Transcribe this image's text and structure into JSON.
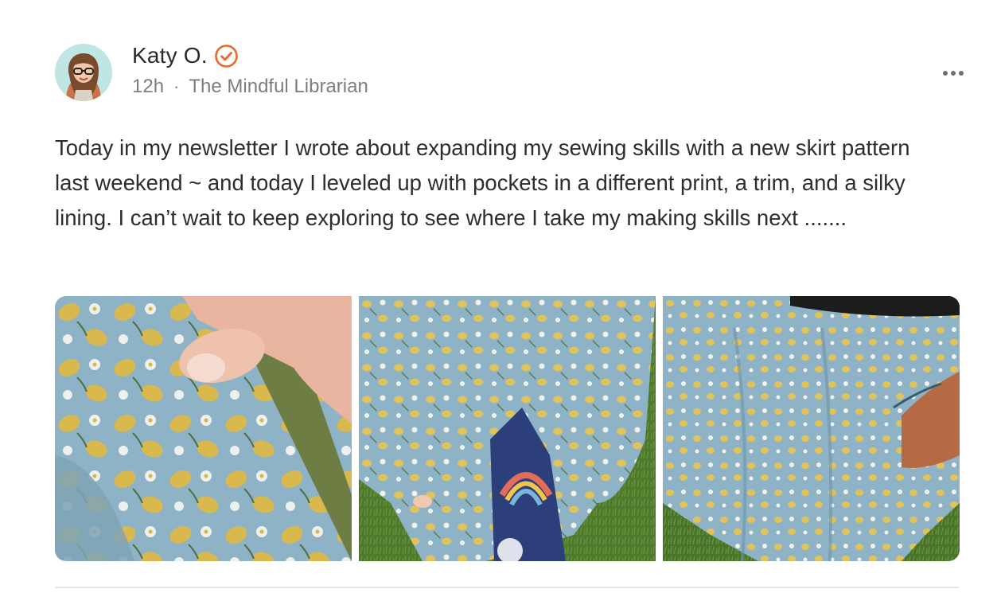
{
  "author": {
    "name": "Katy O.",
    "verified_icon": "verified-check-icon",
    "avatar_icon": "cartoon-avatar-woman-glasses"
  },
  "meta": {
    "time": "12h",
    "separator": "·",
    "publication": "The Mindful Librarian"
  },
  "post": {
    "text": "Today in my newsletter I wrote about expanding my sewing skills with a new skirt pattern last weekend ~ and today I leveled up with pockets in a different print, a trim, and a silky lining. I can’t wait to keep exploring to see where I take my making skills next ......."
  },
  "gallery": {
    "photos": [
      {
        "subject": "Close-up of blue lemon-print fabric with green trim held in fingers"
      },
      {
        "subject": "Lemon-print skirt over grass with rainbow lining peeking out"
      },
      {
        "subject": "Lemon-print skirt with hand in side pocket over grass"
      }
    ]
  },
  "colors": {
    "verified": "#e8692a",
    "fabric_blue": "#8fb3c6",
    "lemon": "#e2c35a",
    "grass": "#4f7a2c",
    "trim_green": "#6d7d43"
  }
}
